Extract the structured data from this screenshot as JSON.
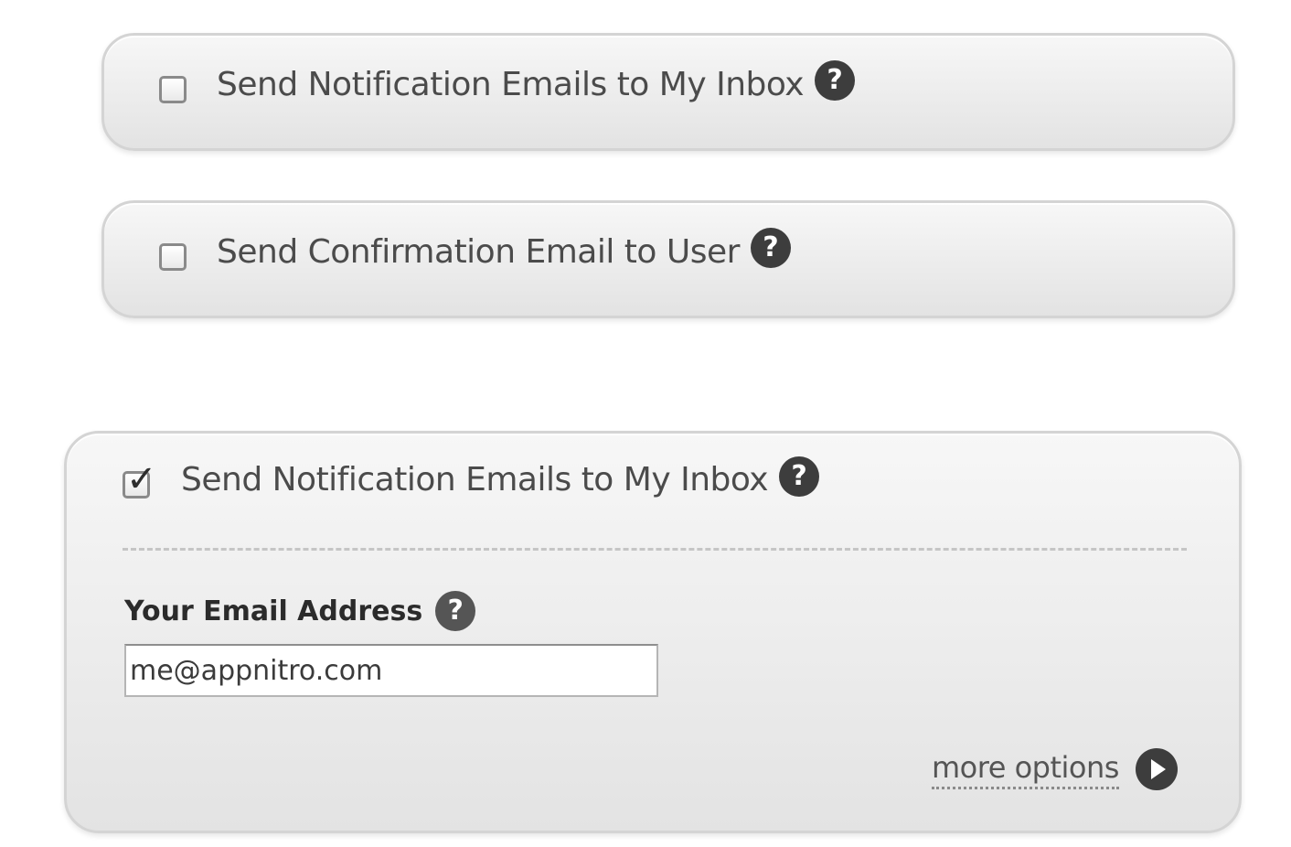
{
  "collapsed_panels": [
    {
      "checkbox_checked": false,
      "label": "Send Notification Emails to My Inbox"
    },
    {
      "checkbox_checked": false,
      "label": "Send Confirmation Email to User"
    }
  ],
  "expanded_panel": {
    "checkbox_checked": true,
    "label": "Send Notification Emails to My Inbox",
    "email_field": {
      "label": "Your Email Address",
      "value": "me@appnitro.com"
    },
    "more_options_label": "more options"
  },
  "icons": {
    "help": "question-circle-icon",
    "more": "play-circle-icon",
    "check": "checkmark-icon"
  },
  "colors": {
    "panel_border": "#d4d4d4",
    "icon_dark": "#3d3d3d",
    "label_text": "#4b4b4b"
  }
}
